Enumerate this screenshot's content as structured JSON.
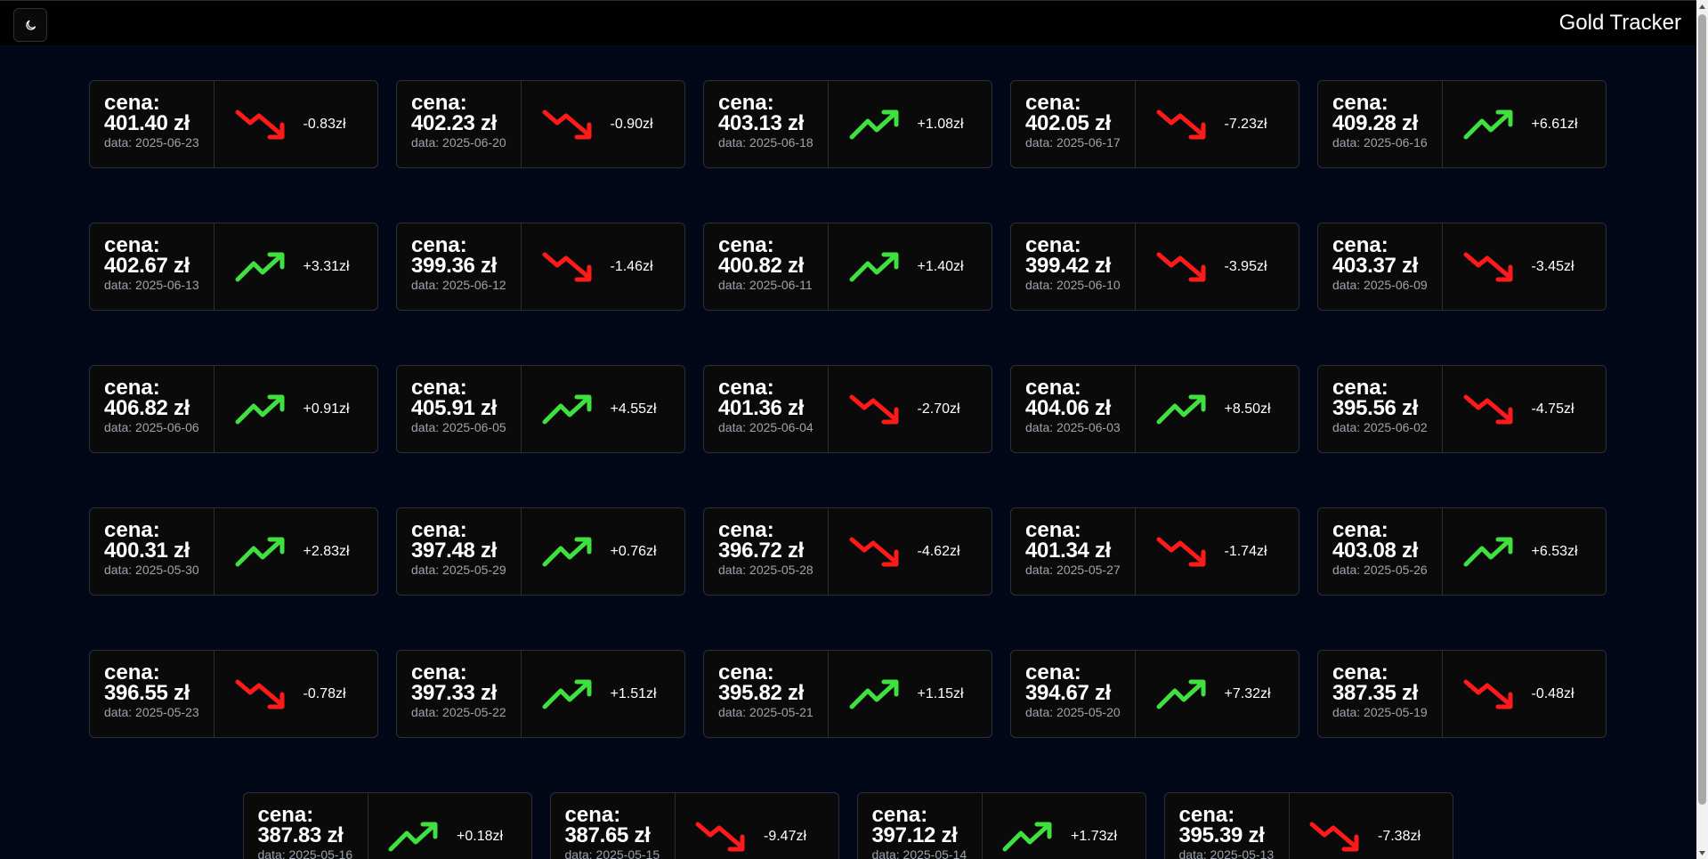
{
  "header": {
    "title": "Gold Tracker",
    "theme_toggle_icon": "moon-icon"
  },
  "colors": {
    "up": "#3fe03f",
    "down": "#ff1a1a",
    "background": "#020817",
    "card": "#0a0a0a"
  },
  "price_label": "cena:",
  "cards": [
    {
      "price": "401.40 zł",
      "date": "data: 2025-06-23",
      "change": "-0.83zł",
      "trend": "down"
    },
    {
      "price": "402.23 zł",
      "date": "data: 2025-06-20",
      "change": "-0.90zł",
      "trend": "down"
    },
    {
      "price": "403.13 zł",
      "date": "data: 2025-06-18",
      "change": "+1.08zł",
      "trend": "up"
    },
    {
      "price": "402.05 zł",
      "date": "data: 2025-06-17",
      "change": "-7.23zł",
      "trend": "down"
    },
    {
      "price": "409.28 zł",
      "date": "data: 2025-06-16",
      "change": "+6.61zł",
      "trend": "up"
    },
    {
      "price": "402.67 zł",
      "date": "data: 2025-06-13",
      "change": "+3.31zł",
      "trend": "up"
    },
    {
      "price": "399.36 zł",
      "date": "data: 2025-06-12",
      "change": "-1.46zł",
      "trend": "down"
    },
    {
      "price": "400.82 zł",
      "date": "data: 2025-06-11",
      "change": "+1.40zł",
      "trend": "up"
    },
    {
      "price": "399.42 zł",
      "date": "data: 2025-06-10",
      "change": "-3.95zł",
      "trend": "down"
    },
    {
      "price": "403.37 zł",
      "date": "data: 2025-06-09",
      "change": "-3.45zł",
      "trend": "down"
    },
    {
      "price": "406.82 zł",
      "date": "data: 2025-06-06",
      "change": "+0.91zł",
      "trend": "up"
    },
    {
      "price": "405.91 zł",
      "date": "data: 2025-06-05",
      "change": "+4.55zł",
      "trend": "up"
    },
    {
      "price": "401.36 zł",
      "date": "data: 2025-06-04",
      "change": "-2.70zł",
      "trend": "down"
    },
    {
      "price": "404.06 zł",
      "date": "data: 2025-06-03",
      "change": "+8.50zł",
      "trend": "up"
    },
    {
      "price": "395.56 zł",
      "date": "data: 2025-06-02",
      "change": "-4.75zł",
      "trend": "down"
    },
    {
      "price": "400.31 zł",
      "date": "data: 2025-05-30",
      "change": "+2.83zł",
      "trend": "up"
    },
    {
      "price": "397.48 zł",
      "date": "data: 2025-05-29",
      "change": "+0.76zł",
      "trend": "up"
    },
    {
      "price": "396.72 zł",
      "date": "data: 2025-05-28",
      "change": "-4.62zł",
      "trend": "down"
    },
    {
      "price": "401.34 zł",
      "date": "data: 2025-05-27",
      "change": "-1.74zł",
      "trend": "down"
    },
    {
      "price": "403.08 zł",
      "date": "data: 2025-05-26",
      "change": "+6.53zł",
      "trend": "up"
    },
    {
      "price": "396.55 zł",
      "date": "data: 2025-05-23",
      "change": "-0.78zł",
      "trend": "down"
    },
    {
      "price": "397.33 zł",
      "date": "data: 2025-05-22",
      "change": "+1.51zł",
      "trend": "up"
    },
    {
      "price": "395.82 zł",
      "date": "data: 2025-05-21",
      "change": "+1.15zł",
      "trend": "up"
    },
    {
      "price": "394.67 zł",
      "date": "data: 2025-05-20",
      "change": "+7.32zł",
      "trend": "up"
    },
    {
      "price": "387.35 zł",
      "date": "data: 2025-05-19",
      "change": "-0.48zł",
      "trend": "down"
    },
    {
      "price": "387.83 zł",
      "date": "data: 2025-05-16",
      "change": "+0.18zł",
      "trend": "up"
    },
    {
      "price": "387.65 zł",
      "date": "data: 2025-05-15",
      "change": "-9.47zł",
      "trend": "down"
    },
    {
      "price": "397.12 zł",
      "date": "data: 2025-05-14",
      "change": "+1.73zł",
      "trend": "up"
    },
    {
      "price": "395.39 zł",
      "date": "data: 2025-05-13",
      "change": "-7.38zł",
      "trend": "down"
    }
  ]
}
